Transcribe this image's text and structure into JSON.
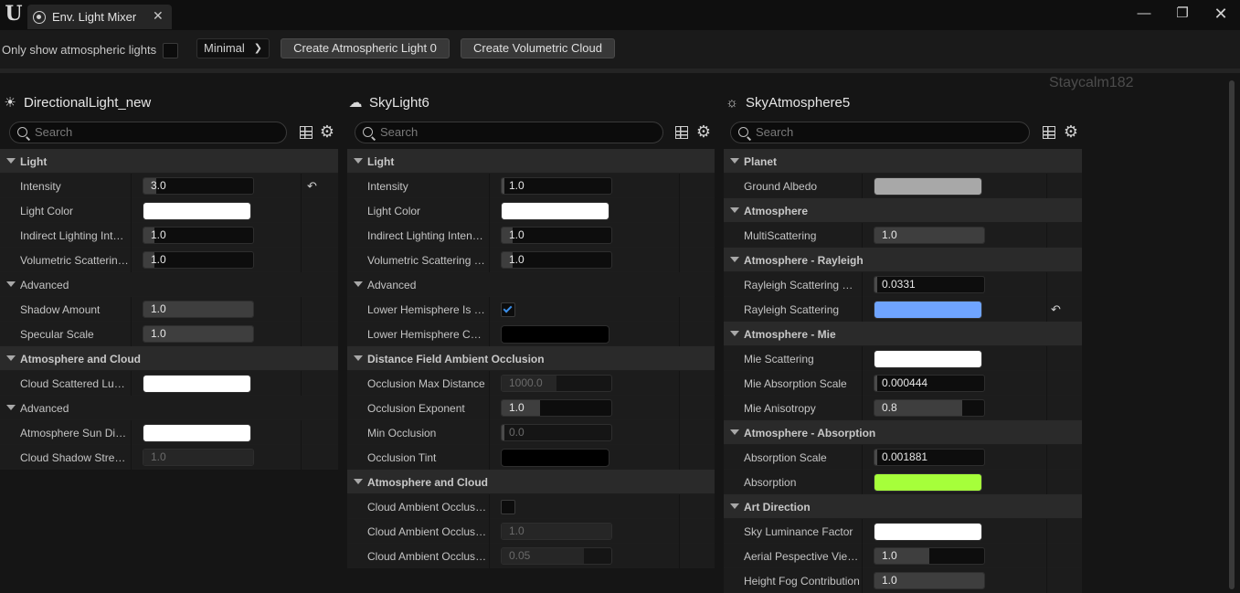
{
  "window": {
    "tab_title": "Env. Light Mixer",
    "tab_close": "✕",
    "minimize": "—",
    "restore": "❐",
    "close": "✕",
    "logo": "U"
  },
  "toolbar": {
    "only_atmospheric_label": "Only show atmospheric lights",
    "only_atmospheric_checked": false,
    "mode_value": "Minimal",
    "create_atmospheric_light": "Create Atmospheric Light 0",
    "create_volumetric_cloud": "Create Volumetric Cloud"
  },
  "watermark": "Staycalm182",
  "search_placeholder": "Search",
  "panels": [
    {
      "title": "DirectionalLight_new",
      "icon": "sun-light-icon",
      "rows": [
        {
          "type": "section",
          "label": "Light"
        },
        {
          "type": "number",
          "label": "Intensity",
          "value": "3.0",
          "fill": 0.12,
          "reset": true
        },
        {
          "type": "color",
          "label": "Light Color",
          "color": "#ffffff"
        },
        {
          "type": "number",
          "label": "Indirect Lighting Inten...",
          "value": "1.0",
          "fill": 0.1
        },
        {
          "type": "number",
          "label": "Volumetric Scattering...",
          "value": "1.0",
          "fill": 0.1
        },
        {
          "type": "subsection",
          "label": "Advanced"
        },
        {
          "type": "number",
          "label": "Shadow Amount",
          "value": "1.0",
          "fill": 1.0
        },
        {
          "type": "number",
          "label": "Specular Scale",
          "value": "1.0",
          "fill": 1.0
        },
        {
          "type": "section",
          "label": "Atmosphere and Cloud"
        },
        {
          "type": "color",
          "label": "Cloud Scattered Lumi...",
          "color": "#ffffff"
        },
        {
          "type": "subsection",
          "label": "Advanced"
        },
        {
          "type": "color",
          "label": "Atmosphere Sun Disk...",
          "color": "#ffffff"
        },
        {
          "type": "number",
          "label": "Cloud Shadow Strength",
          "value": "1.0",
          "fill": 1.0,
          "disabled": true
        }
      ]
    },
    {
      "title": "SkyLight6",
      "icon": "sky-light-icon",
      "rows": [
        {
          "type": "section",
          "label": "Light"
        },
        {
          "type": "number",
          "label": "Intensity",
          "value": "1.0",
          "fill": 0.0
        },
        {
          "type": "color",
          "label": "Light Color",
          "color": "#ffffff"
        },
        {
          "type": "number",
          "label": "Indirect Lighting Intensity",
          "value": "1.0",
          "fill": 0.1
        },
        {
          "type": "number",
          "label": "Volumetric Scattering In...",
          "value": "1.0",
          "fill": 0.1
        },
        {
          "type": "subsection",
          "label": "Advanced"
        },
        {
          "type": "checkbox",
          "label": "Lower Hemisphere Is Sol...",
          "checked": true
        },
        {
          "type": "color",
          "label": "Lower Hemisphere Color",
          "color": "#000000"
        },
        {
          "type": "section",
          "label": "Distance Field Ambient Occlusion"
        },
        {
          "type": "number",
          "label": "Occlusion Max Distance",
          "value": "1000.0",
          "fill": 0.5,
          "disabled": true
        },
        {
          "type": "number",
          "label": "Occlusion Exponent",
          "value": "1.0",
          "fill": 0.35
        },
        {
          "type": "number",
          "label": "Min Occlusion",
          "value": "0.0",
          "fill": 0.0,
          "disabled": true
        },
        {
          "type": "color",
          "label": "Occlusion Tint",
          "color": "#000000"
        },
        {
          "type": "section",
          "label": "Atmosphere and Cloud"
        },
        {
          "type": "checkbox",
          "label": "Cloud Ambient Occlusion",
          "checked": false
        },
        {
          "type": "number",
          "label": "Cloud Ambient Occlusio...",
          "value": "1.0",
          "fill": 1.0,
          "disabled": true
        },
        {
          "type": "number",
          "label": "Cloud Ambient Occlusio...",
          "value": "0.05",
          "fill": 0.75,
          "disabled": true
        }
      ]
    },
    {
      "title": "SkyAtmosphere5",
      "icon": "sky-atmosphere-icon",
      "rows": [
        {
          "type": "section",
          "label": "Planet"
        },
        {
          "type": "color",
          "label": "Ground Albedo",
          "color": "#a8a8a8"
        },
        {
          "type": "section",
          "label": "Atmosphere"
        },
        {
          "type": "number",
          "label": "MultiScattering",
          "value": "1.0",
          "fill": 1.0
        },
        {
          "type": "section",
          "label": "Atmosphere - Rayleigh"
        },
        {
          "type": "number",
          "label": "Rayleigh Scattering Sca...",
          "value": "0.0331",
          "fill": 0.0
        },
        {
          "type": "color",
          "label": "Rayleigh Scattering",
          "color": "#6fa4ff",
          "reset": true
        },
        {
          "type": "section",
          "label": "Atmosphere - Mie"
        },
        {
          "type": "color",
          "label": "Mie Scattering",
          "color": "#ffffff"
        },
        {
          "type": "number",
          "label": "Mie Absorption Scale",
          "value": "0.000444",
          "fill": 0.0
        },
        {
          "type": "number",
          "label": "Mie Anisotropy",
          "value": "0.8",
          "fill": 0.8
        },
        {
          "type": "section",
          "label": "Atmosphere - Absorption"
        },
        {
          "type": "number",
          "label": "Absorption Scale",
          "value": "0.001881",
          "fill": 0.0
        },
        {
          "type": "color",
          "label": "Absorption",
          "color": "#a6ff3a"
        },
        {
          "type": "section",
          "label": "Art Direction"
        },
        {
          "type": "color",
          "label": "Sky Luminance Factor",
          "color": "#ffffff"
        },
        {
          "type": "number",
          "label": "Aerial Pespective View...",
          "value": "1.0",
          "fill": 0.5
        },
        {
          "type": "number",
          "label": "Height Fog Contribution",
          "value": "1.0",
          "fill": 1.0
        }
      ]
    }
  ]
}
